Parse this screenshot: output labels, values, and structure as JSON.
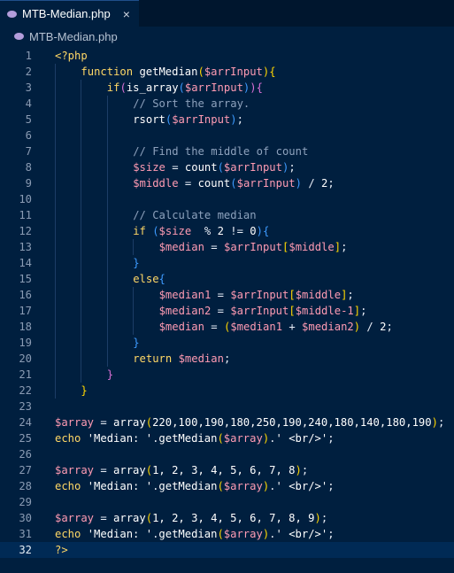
{
  "tab": {
    "title": "MTB-Median.php",
    "close_glyph": "×",
    "icon": "php-elephant-icon"
  },
  "breadcrumb": {
    "file": "MTB-Median.php",
    "icon": "php-elephant-icon"
  },
  "editor": {
    "current_line": 32,
    "lines": [
      {
        "n": "1",
        "indent": 0,
        "tokens": [
          [
            "kw",
            "<?php"
          ]
        ]
      },
      {
        "n": "2",
        "indent": 1,
        "tokens": [
          [
            "kw",
            "function "
          ],
          [
            "fn",
            "getMedian"
          ],
          [
            "br1",
            "("
          ],
          [
            "var",
            "$arrInput"
          ],
          [
            "br1",
            "){"
          ]
        ]
      },
      {
        "n": "3",
        "indent": 2,
        "tokens": [
          [
            "kw",
            "if"
          ],
          [
            "br2",
            "("
          ],
          [
            "fn",
            "is_array"
          ],
          [
            "br3",
            "("
          ],
          [
            "var",
            "$arrInput"
          ],
          [
            "br3",
            ")"
          ],
          [
            "br2",
            "){"
          ]
        ]
      },
      {
        "n": "4",
        "indent": 3,
        "tokens": [
          [
            "cm",
            "// Sort the array."
          ]
        ]
      },
      {
        "n": "5",
        "indent": 3,
        "tokens": [
          [
            "fn",
            "rsort"
          ],
          [
            "br3",
            "("
          ],
          [
            "var",
            "$arrInput"
          ],
          [
            "br3",
            ")"
          ],
          [
            "op",
            ";"
          ]
        ]
      },
      {
        "n": "6",
        "indent": 3,
        "tokens": []
      },
      {
        "n": "7",
        "indent": 3,
        "tokens": [
          [
            "cm",
            "// Find the middle of count"
          ]
        ]
      },
      {
        "n": "8",
        "indent": 3,
        "tokens": [
          [
            "var",
            "$size"
          ],
          [
            "op",
            " = "
          ],
          [
            "fn",
            "count"
          ],
          [
            "br3",
            "("
          ],
          [
            "var",
            "$arrInput"
          ],
          [
            "br3",
            ")"
          ],
          [
            "op",
            ";"
          ]
        ]
      },
      {
        "n": "9",
        "indent": 3,
        "tokens": [
          [
            "var",
            "$middle"
          ],
          [
            "op",
            " = "
          ],
          [
            "fn",
            "count"
          ],
          [
            "br3",
            "("
          ],
          [
            "var",
            "$arrInput"
          ],
          [
            "br3",
            ")"
          ],
          [
            "op",
            " / "
          ],
          [
            "num",
            "2"
          ],
          [
            "op",
            ";"
          ]
        ]
      },
      {
        "n": "10",
        "indent": 3,
        "tokens": []
      },
      {
        "n": "11",
        "indent": 3,
        "tokens": [
          [
            "cm",
            "// Calculate median"
          ]
        ]
      },
      {
        "n": "12",
        "indent": 3,
        "tokens": [
          [
            "kw",
            "if "
          ],
          [
            "br3",
            "("
          ],
          [
            "var",
            "$size"
          ],
          [
            "op",
            "  % "
          ],
          [
            "num",
            "2"
          ],
          [
            "op",
            " != "
          ],
          [
            "num",
            "0"
          ],
          [
            "br3",
            ")"
          ],
          [
            "br3",
            "{"
          ]
        ]
      },
      {
        "n": "13",
        "indent": 4,
        "tokens": [
          [
            "var",
            "$median"
          ],
          [
            "op",
            " = "
          ],
          [
            "var",
            "$arrInput"
          ],
          [
            "br1",
            "["
          ],
          [
            "var",
            "$middle"
          ],
          [
            "br1",
            "]"
          ],
          [
            "op",
            ";"
          ]
        ]
      },
      {
        "n": "14",
        "indent": 3,
        "tokens": [
          [
            "br3",
            "}"
          ]
        ]
      },
      {
        "n": "15",
        "indent": 3,
        "tokens": [
          [
            "kw",
            "else"
          ],
          [
            "br3",
            "{"
          ]
        ]
      },
      {
        "n": "16",
        "indent": 4,
        "tokens": [
          [
            "var",
            "$median1"
          ],
          [
            "op",
            " = "
          ],
          [
            "var",
            "$arrInput"
          ],
          [
            "br1",
            "["
          ],
          [
            "var",
            "$middle"
          ],
          [
            "br1",
            "]"
          ],
          [
            "op",
            ";"
          ]
        ]
      },
      {
        "n": "17",
        "indent": 4,
        "tokens": [
          [
            "var",
            "$median2"
          ],
          [
            "op",
            " = "
          ],
          [
            "var",
            "$arrInput"
          ],
          [
            "br1",
            "["
          ],
          [
            "var",
            "$middle-1"
          ],
          [
            "br1",
            "]"
          ],
          [
            "op",
            ";"
          ]
        ]
      },
      {
        "n": "18",
        "indent": 4,
        "tokens": [
          [
            "var",
            "$median"
          ],
          [
            "op",
            " = "
          ],
          [
            "br1",
            "("
          ],
          [
            "var",
            "$median1"
          ],
          [
            "op",
            " + "
          ],
          [
            "var",
            "$median2"
          ],
          [
            "br1",
            ")"
          ],
          [
            "op",
            " / "
          ],
          [
            "num",
            "2"
          ],
          [
            "op",
            ";"
          ]
        ]
      },
      {
        "n": "19",
        "indent": 3,
        "tokens": [
          [
            "br3",
            "}"
          ]
        ]
      },
      {
        "n": "20",
        "indent": 3,
        "tokens": [
          [
            "kw",
            "return "
          ],
          [
            "var",
            "$median"
          ],
          [
            "op",
            ";"
          ]
        ]
      },
      {
        "n": "21",
        "indent": 2,
        "tokens": [
          [
            "br2",
            "}"
          ]
        ]
      },
      {
        "n": "22",
        "indent": 1,
        "tokens": [
          [
            "br1",
            "}"
          ]
        ]
      },
      {
        "n": "23",
        "indent": 0,
        "tokens": []
      },
      {
        "n": "24",
        "indent": 0,
        "tokens": [
          [
            "var",
            "$array"
          ],
          [
            "op",
            " = "
          ],
          [
            "fn",
            "array"
          ],
          [
            "br1",
            "("
          ],
          [
            "num",
            "220,100,190,180,250,190,240,180,140,180,190"
          ],
          [
            "br1",
            ")"
          ],
          [
            "op",
            ";"
          ]
        ]
      },
      {
        "n": "25",
        "indent": 0,
        "tokens": [
          [
            "kw",
            "echo "
          ],
          [
            "str",
            "'Median: '"
          ],
          [
            "op",
            "."
          ],
          [
            "fn",
            "getMedian"
          ],
          [
            "br1",
            "("
          ],
          [
            "var",
            "$array"
          ],
          [
            "br1",
            ")"
          ],
          [
            "op",
            "."
          ],
          [
            "str",
            "' <br/>'"
          ],
          [
            "op",
            ";"
          ]
        ]
      },
      {
        "n": "26",
        "indent": 0,
        "tokens": []
      },
      {
        "n": "27",
        "indent": 0,
        "tokens": [
          [
            "var",
            "$array"
          ],
          [
            "op",
            " = "
          ],
          [
            "fn",
            "array"
          ],
          [
            "br1",
            "("
          ],
          [
            "num",
            "1, 2, 3, 4, 5, 6, 7, 8"
          ],
          [
            "br1",
            ")"
          ],
          [
            "op",
            ";"
          ]
        ]
      },
      {
        "n": "28",
        "indent": 0,
        "tokens": [
          [
            "kw",
            "echo "
          ],
          [
            "str",
            "'Median: '"
          ],
          [
            "op",
            "."
          ],
          [
            "fn",
            "getMedian"
          ],
          [
            "br1",
            "("
          ],
          [
            "var",
            "$array"
          ],
          [
            "br1",
            ")"
          ],
          [
            "op",
            "."
          ],
          [
            "str",
            "' <br/>'"
          ],
          [
            "op",
            ";"
          ]
        ]
      },
      {
        "n": "29",
        "indent": 0,
        "tokens": []
      },
      {
        "n": "30",
        "indent": 0,
        "tokens": [
          [
            "var",
            "$array"
          ],
          [
            "op",
            " = "
          ],
          [
            "fn",
            "array"
          ],
          [
            "br1",
            "("
          ],
          [
            "num",
            "1, 2, 3, 4, 5, 6, 7, 8, 9"
          ],
          [
            "br1",
            ")"
          ],
          [
            "op",
            ";"
          ]
        ]
      },
      {
        "n": "31",
        "indent": 0,
        "tokens": [
          [
            "kw",
            "echo "
          ],
          [
            "str",
            "'Median: '"
          ],
          [
            "op",
            "."
          ],
          [
            "fn",
            "getMedian"
          ],
          [
            "br1",
            "("
          ],
          [
            "var",
            "$array"
          ],
          [
            "br1",
            ")"
          ],
          [
            "op",
            "."
          ],
          [
            "str",
            "' <br/>'"
          ],
          [
            "op",
            ";"
          ]
        ]
      },
      {
        "n": "32",
        "indent": 0,
        "tokens": [
          [
            "kw",
            "?>"
          ]
        ]
      }
    ]
  }
}
